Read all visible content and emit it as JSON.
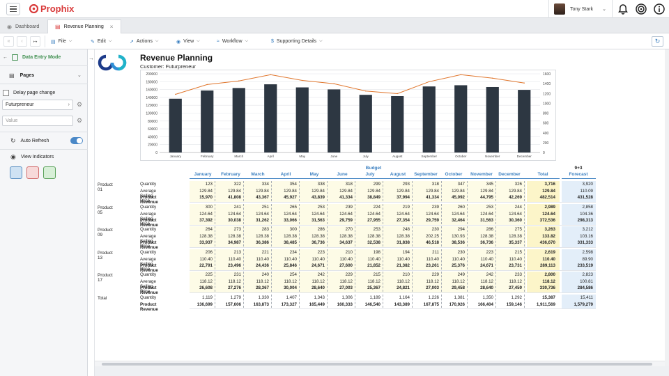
{
  "brand": {
    "name": "Prophix"
  },
  "user": {
    "name": "Tony Stark"
  },
  "tabs": [
    {
      "label": "Dashboard"
    },
    {
      "label": "Revenue Planning"
    }
  ],
  "toolbar": {
    "file": "File",
    "edit": "Edit",
    "actions": "Actions",
    "view": "View",
    "workflow": "Workflow",
    "supporting": "Supporting Details"
  },
  "sidebar": {
    "mode": "Data Entry Mode",
    "pages": "Pages",
    "delay": "Delay page change",
    "page_select": "Futurpreneur",
    "value_placeholder": "Value",
    "auto_refresh": "Auto Refresh",
    "view_indicators": "View Indicators"
  },
  "report": {
    "title": "Revenue Planning",
    "customer": "Customer: Futurpreneur"
  },
  "chart_data": {
    "type": "bar",
    "categories": [
      "January",
      "February",
      "March",
      "April",
      "May",
      "June",
      "July",
      "August",
      "September",
      "October",
      "November",
      "December"
    ],
    "series": [
      {
        "values": [
          136699,
          157606,
          163873,
          173327,
          165449,
          160333,
          146540,
          143389,
          167875,
          170926,
          166404,
          159146
        ],
        "color": "#2d3742"
      },
      {
        "values": [
          1183,
          1382,
          1455,
          1581,
          1465,
          1398,
          1250,
          1197,
          1440,
          1581,
          1511,
          1413
        ],
        "color": "#e0752b",
        "axis": "right"
      }
    ],
    "ylim": [
      0,
      200000
    ],
    "y2lim": [
      0,
      1600
    ],
    "yticks": [
      "0",
      "20000",
      "40000",
      "60000",
      "80000",
      "100000",
      "120000",
      "140000",
      "160000",
      "180000",
      "200000"
    ],
    "y2ticks": [
      "0",
      "200",
      "400",
      "600",
      "800",
      "1000",
      "1200",
      "1400",
      "1600"
    ],
    "grid": true
  },
  "table": {
    "budget_label": "Budget",
    "months": [
      "January",
      "February",
      "March",
      "April",
      "May",
      "June",
      "July",
      "August",
      "September",
      "October",
      "November",
      "December"
    ],
    "total_label": "Total",
    "forecast_label1": "9+3",
    "forecast_label2": "Forecast",
    "groups": [
      {
        "product": "Product 01",
        "rows": [
          {
            "label": "Quantity",
            "values": [
              "123",
              "322",
              "334",
              "354",
              "338",
              "318",
              "299",
              "293",
              "318",
              "347",
              "345",
              "326"
            ],
            "total": "3,716",
            "forecast": "3,920"
          },
          {
            "label": "Average Selling Price",
            "values": [
              "129.84",
              "129.84",
              "129.84",
              "129.84",
              "129.84",
              "129.84",
              "129.84",
              "129.84",
              "129.84",
              "129.84",
              "129.84",
              "129.84"
            ],
            "total": "129.84",
            "forecast": "110.09"
          },
          {
            "label": "Product Revenue",
            "values": [
              "15,970",
              "41,808",
              "43,367",
              "45,927",
              "43,839",
              "41,334",
              "38,849",
              "37,994",
              "41,334",
              "45,092",
              "44,795",
              "42,269"
            ],
            "total": "482,514",
            "forecast": "431,528"
          }
        ]
      },
      {
        "product": "Product 05",
        "rows": [
          {
            "label": "Quantity",
            "values": [
              "300",
              "241",
              "251",
              "265",
              "253",
              "239",
              "224",
              "219",
              "239",
              "260",
              "253",
              "244"
            ],
            "total": "2,989",
            "forecast": "2,858"
          },
          {
            "label": "Average Selling Price",
            "values": [
              "124.64",
              "124.64",
              "124.64",
              "124.64",
              "124.64",
              "124.64",
              "124.64",
              "124.64",
              "124.64",
              "124.64",
              "124.64",
              "124.64"
            ],
            "total": "124.64",
            "forecast": "104.36"
          },
          {
            "label": "Product Revenue",
            "values": [
              "37,392",
              "30,038",
              "31,262",
              "33,066",
              "31,563",
              "29,759",
              "27,955",
              "27,354",
              "29,759",
              "32,464",
              "31,563",
              "30,360"
            ],
            "total": "372,536",
            "forecast": "298,313"
          }
        ]
      },
      {
        "product": "Product 09",
        "rows": [
          {
            "label": "Quantity",
            "values": [
              "264",
              "273",
              "283",
              "300",
              "286",
              "270",
              "253",
              "248",
              "230",
              "294",
              "286",
              "275"
            ],
            "total": "3,263",
            "forecast": "3,212"
          },
          {
            "label": "Average Selling Price",
            "values": [
              "128.38",
              "128.38",
              "128.38",
              "128.38",
              "128.38",
              "128.38",
              "128.38",
              "128.38",
              "202.25",
              "130.93",
              "128.38",
              "128.38"
            ],
            "total": "133.82",
            "forecast": "103.16"
          },
          {
            "label": "Product Revenue",
            "values": [
              "33,937",
              "34,987",
              "36,386",
              "38,485",
              "36,736",
              "34,637",
              "32,538",
              "31,838",
              "46,518",
              "38,536",
              "36,736",
              "35,337"
            ],
            "total": "436,670",
            "forecast": "331,333"
          }
        ]
      },
      {
        "product": "Product 13",
        "rows": [
          {
            "label": "Quantity",
            "values": [
              "206",
              "213",
              "221",
              "234",
              "223",
              "210",
              "198",
              "194",
              "211",
              "230",
              "223",
              "215"
            ],
            "total": "2,619",
            "forecast": "2,598"
          },
          {
            "label": "Average Selling Price",
            "values": [
              "110.40",
              "110.40",
              "110.40",
              "110.40",
              "110.40",
              "110.40",
              "110.40",
              "110.40",
              "110.40",
              "110.40",
              "110.40",
              "110.40"
            ],
            "total": "110.40",
            "forecast": "89.90"
          },
          {
            "label": "Product Revenue",
            "values": [
              "22,791",
              "23,496",
              "24,436",
              "25,846",
              "24,671",
              "27,600",
              "21,852",
              "21,382",
              "23,261",
              "25,376",
              "24,671",
              "23,731"
            ],
            "total": "289,113",
            "forecast": "233,519"
          }
        ]
      },
      {
        "product": "Product 17",
        "rows": [
          {
            "label": "Quantity",
            "values": [
              "225",
              "231",
              "240",
              "254",
              "242",
              "229",
              "215",
              "210",
              "229",
              "249",
              "242",
              "233"
            ],
            "total": "2,800",
            "forecast": "2,823"
          },
          {
            "label": "Average Selling Price",
            "values": [
              "118.12",
              "118.12",
              "118.12",
              "118.12",
              "118.12",
              "118.12",
              "118.12",
              "118.12",
              "118.12",
              "118.12",
              "118.12",
              "118.12"
            ],
            "total": "118.12",
            "forecast": "100.81"
          },
          {
            "label": "Product Revenue",
            "values": [
              "26,608",
              "27,276",
              "28,367",
              "30,004",
              "28,640",
              "27,003",
              "25,367",
              "24,821",
              "27,003",
              "29,458",
              "28,640",
              "27,459"
            ],
            "total": "330,736",
            "forecast": "284,586"
          }
        ]
      },
      {
        "product": "Total",
        "rows": [
          {
            "label": "Quantity",
            "values": [
              "1,119",
              "1,279",
              "1,330",
              "1,407",
              "1,343",
              "1,306",
              "1,189",
              "1,164",
              "1,226",
              "1,381",
              "1,350",
              "1,292"
            ],
            "total": "15,387",
            "forecast": "15,411"
          },
          {
            "label": "Product Revenue",
            "values": [
              "136,699",
              "157,606",
              "163,873",
              "173,327",
              "165,449",
              "160,333",
              "146,540",
              "143,389",
              "167,875",
              "170,926",
              "166,404",
              "159,146"
            ],
            "total": "1,911,569",
            "forecast": "1,579,279"
          }
        ]
      }
    ]
  }
}
